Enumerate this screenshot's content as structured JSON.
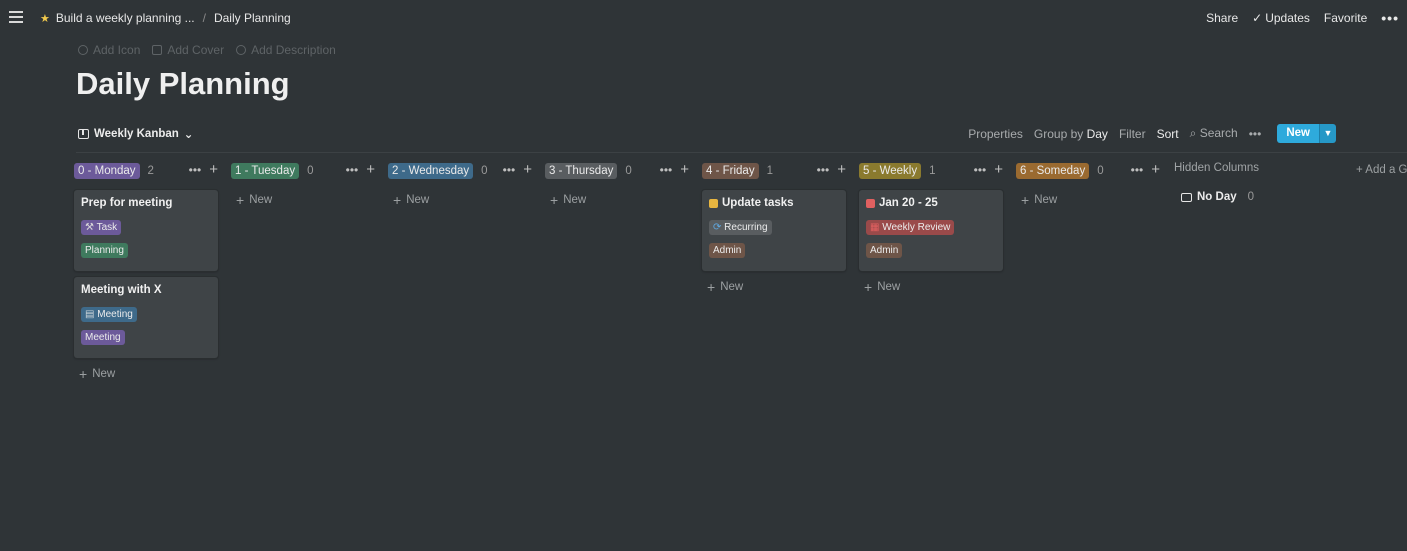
{
  "topbar": {
    "breadcrumb_parent": "Build a weekly planning ...",
    "breadcrumb_current": "Daily Planning",
    "share": "Share",
    "updates": "Updates",
    "favorite": "Favorite",
    "more": "•••"
  },
  "page_actions": {
    "add_icon": "Add Icon",
    "add_cover": "Add Cover",
    "add_description": "Add Description"
  },
  "page_title": "Daily Planning",
  "toolbar": {
    "view_name": "Weekly Kanban",
    "properties": "Properties",
    "group_by_label": "Group by",
    "group_by_value": "Day",
    "filter": "Filter",
    "sort": "Sort",
    "search": "Search",
    "more": "•••",
    "new": "New"
  },
  "columns": [
    {
      "label": "0 - Monday",
      "count": "2",
      "color": "#6c5a9a",
      "new": "New",
      "cards": [
        {
          "title": "Prep for meeting",
          "chips": [
            {
              "text": "Task",
              "color": "#6c5a9a",
              "icon": "hammer-icon"
            },
            {
              "text": "Planning",
              "color": "#3f7a5e"
            }
          ]
        },
        {
          "title": "Meeting with X",
          "chips": [
            {
              "text": "Meeting",
              "color": "#3e6a8a",
              "icon": "notepad-icon"
            },
            {
              "text": "Meeting",
              "color": "#6c5a9a"
            }
          ]
        }
      ]
    },
    {
      "label": "1 - Tuesday",
      "count": "0",
      "color": "#3f7a5e",
      "new": "New",
      "cards": []
    },
    {
      "label": "2 - Wednesday",
      "count": "0",
      "color": "#3e6a8a",
      "new": "New",
      "cards": []
    },
    {
      "label": "3 - Thursday",
      "count": "0",
      "color": "#595d60",
      "new": "New",
      "cards": []
    },
    {
      "label": "4 - Friday",
      "count": "1",
      "color": "#6e5548",
      "new": "New",
      "cards": [
        {
          "title": "Update tasks",
          "title_icon": "folder-icon",
          "chips": [
            {
              "text": "Recurring",
              "color": "#595d60",
              "icon": "repeat-icon"
            },
            {
              "text": "Admin",
              "color": "#6e5548"
            }
          ]
        }
      ]
    },
    {
      "label": "5 - Weekly",
      "count": "1",
      "color": "#8a7a2e",
      "new": "New",
      "cards": [
        {
          "title": "Jan 20 - 25",
          "title_icon": "calendar-icon",
          "chips": [
            {
              "text": "Weekly Review",
              "color": "#9a4a4a",
              "icon": "calendar-icon"
            },
            {
              "text": "Admin",
              "color": "#6e5548"
            }
          ]
        }
      ]
    },
    {
      "label": "6 - Someday",
      "count": "0",
      "color": "#9a6a30",
      "new": "New",
      "cards": []
    }
  ],
  "hidden_columns": {
    "label": "Hidden Columns",
    "no_day": "No Day",
    "no_day_count": "0"
  },
  "add_group": "Add a G"
}
